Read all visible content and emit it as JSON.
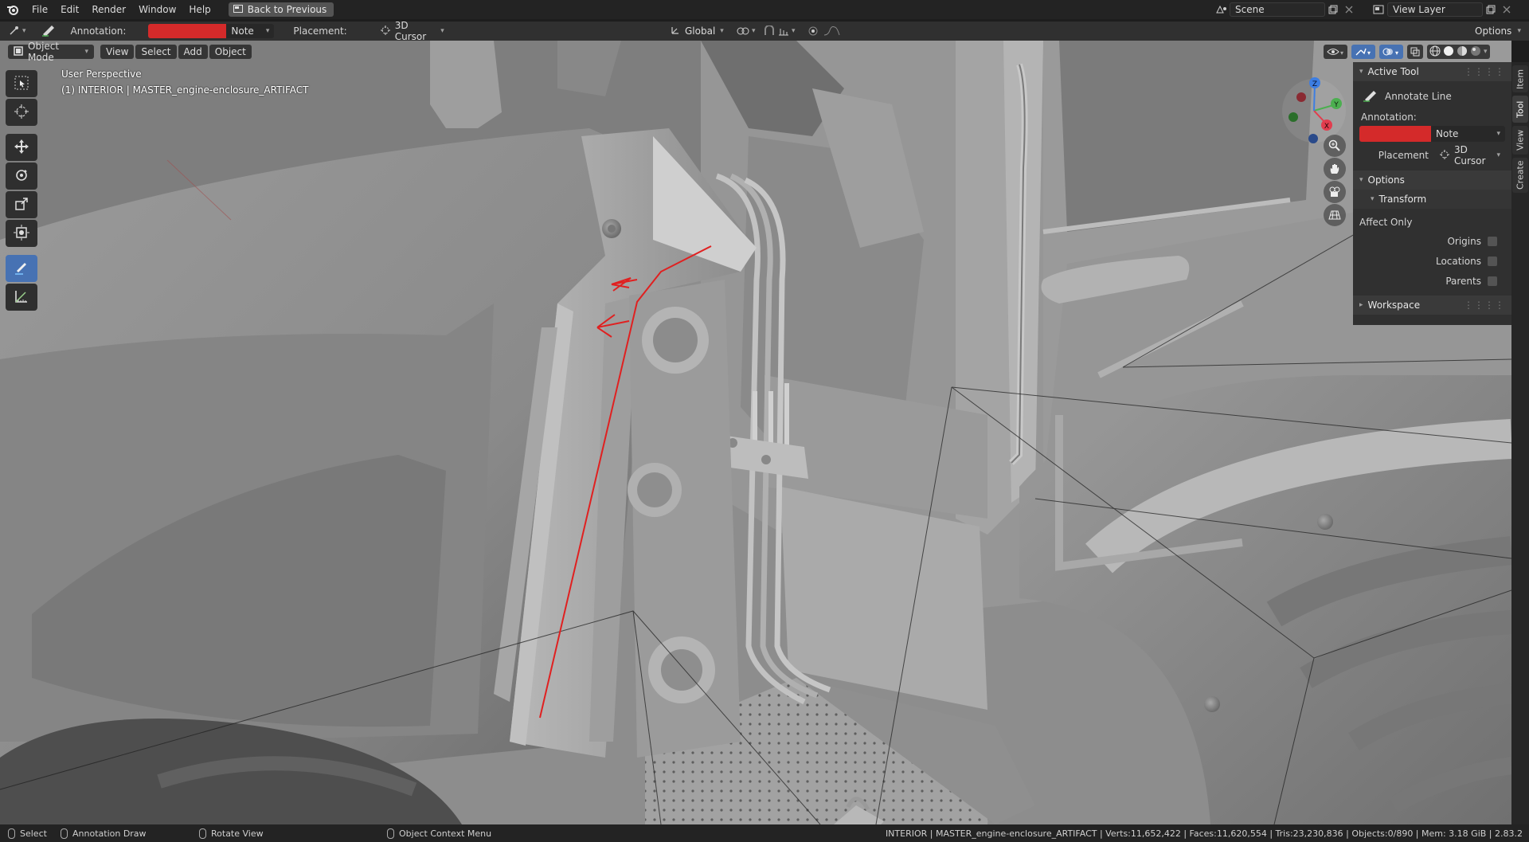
{
  "topbar": {
    "menus": [
      "File",
      "Edit",
      "Render",
      "Window",
      "Help"
    ],
    "back_button": "Back to Previous",
    "scene_name": "Scene",
    "view_layer": "View Layer"
  },
  "toolheader": {
    "annotation_label": "Annotation:",
    "annotation_color": "#d42a2a",
    "note_value": "Note",
    "placement_label": "Placement:",
    "placement_value": "3D Cursor",
    "orientation_value": "Global",
    "options_label": "Options"
  },
  "vpheader": {
    "mode": "Object Mode",
    "view": "View",
    "select": "Select",
    "add": "Add",
    "object": "Object"
  },
  "viewport": {
    "perspective": "User Perspective",
    "object_name": "(1) INTERIOR | MASTER_engine-enclosure_ARTIFACT",
    "annotation_stroke_color": "#e02020",
    "gizmo_axes": {
      "x": "X",
      "y": "Y",
      "z": "Z"
    }
  },
  "npanel": {
    "active_tool_header": "Active Tool",
    "tool_name": "Annotate Line",
    "annotation_label": "Annotation:",
    "note_value": "Note",
    "placement_label": "Placement",
    "placement_value": "3D Cursor",
    "options_header": "Options",
    "transform_header": "Transform",
    "affect_only": "Affect Only",
    "origins": "Origins",
    "locations": "Locations",
    "parents": "Parents",
    "workspace_header": "Workspace"
  },
  "tabs": [
    "Item",
    "Tool",
    "View",
    "Create"
  ],
  "statusbar": {
    "select": "Select",
    "annotation_draw": "Annotation Draw",
    "rotate_view": "Rotate View",
    "context_menu": "Object Context Menu",
    "stats": "INTERIOR | MASTER_engine-enclosure_ARTIFACT | Verts:11,652,422 | Faces:11,620,554 | Tris:23,230,836 | Objects:0/890 | Mem: 3.18 GiB | 2.83.2"
  }
}
